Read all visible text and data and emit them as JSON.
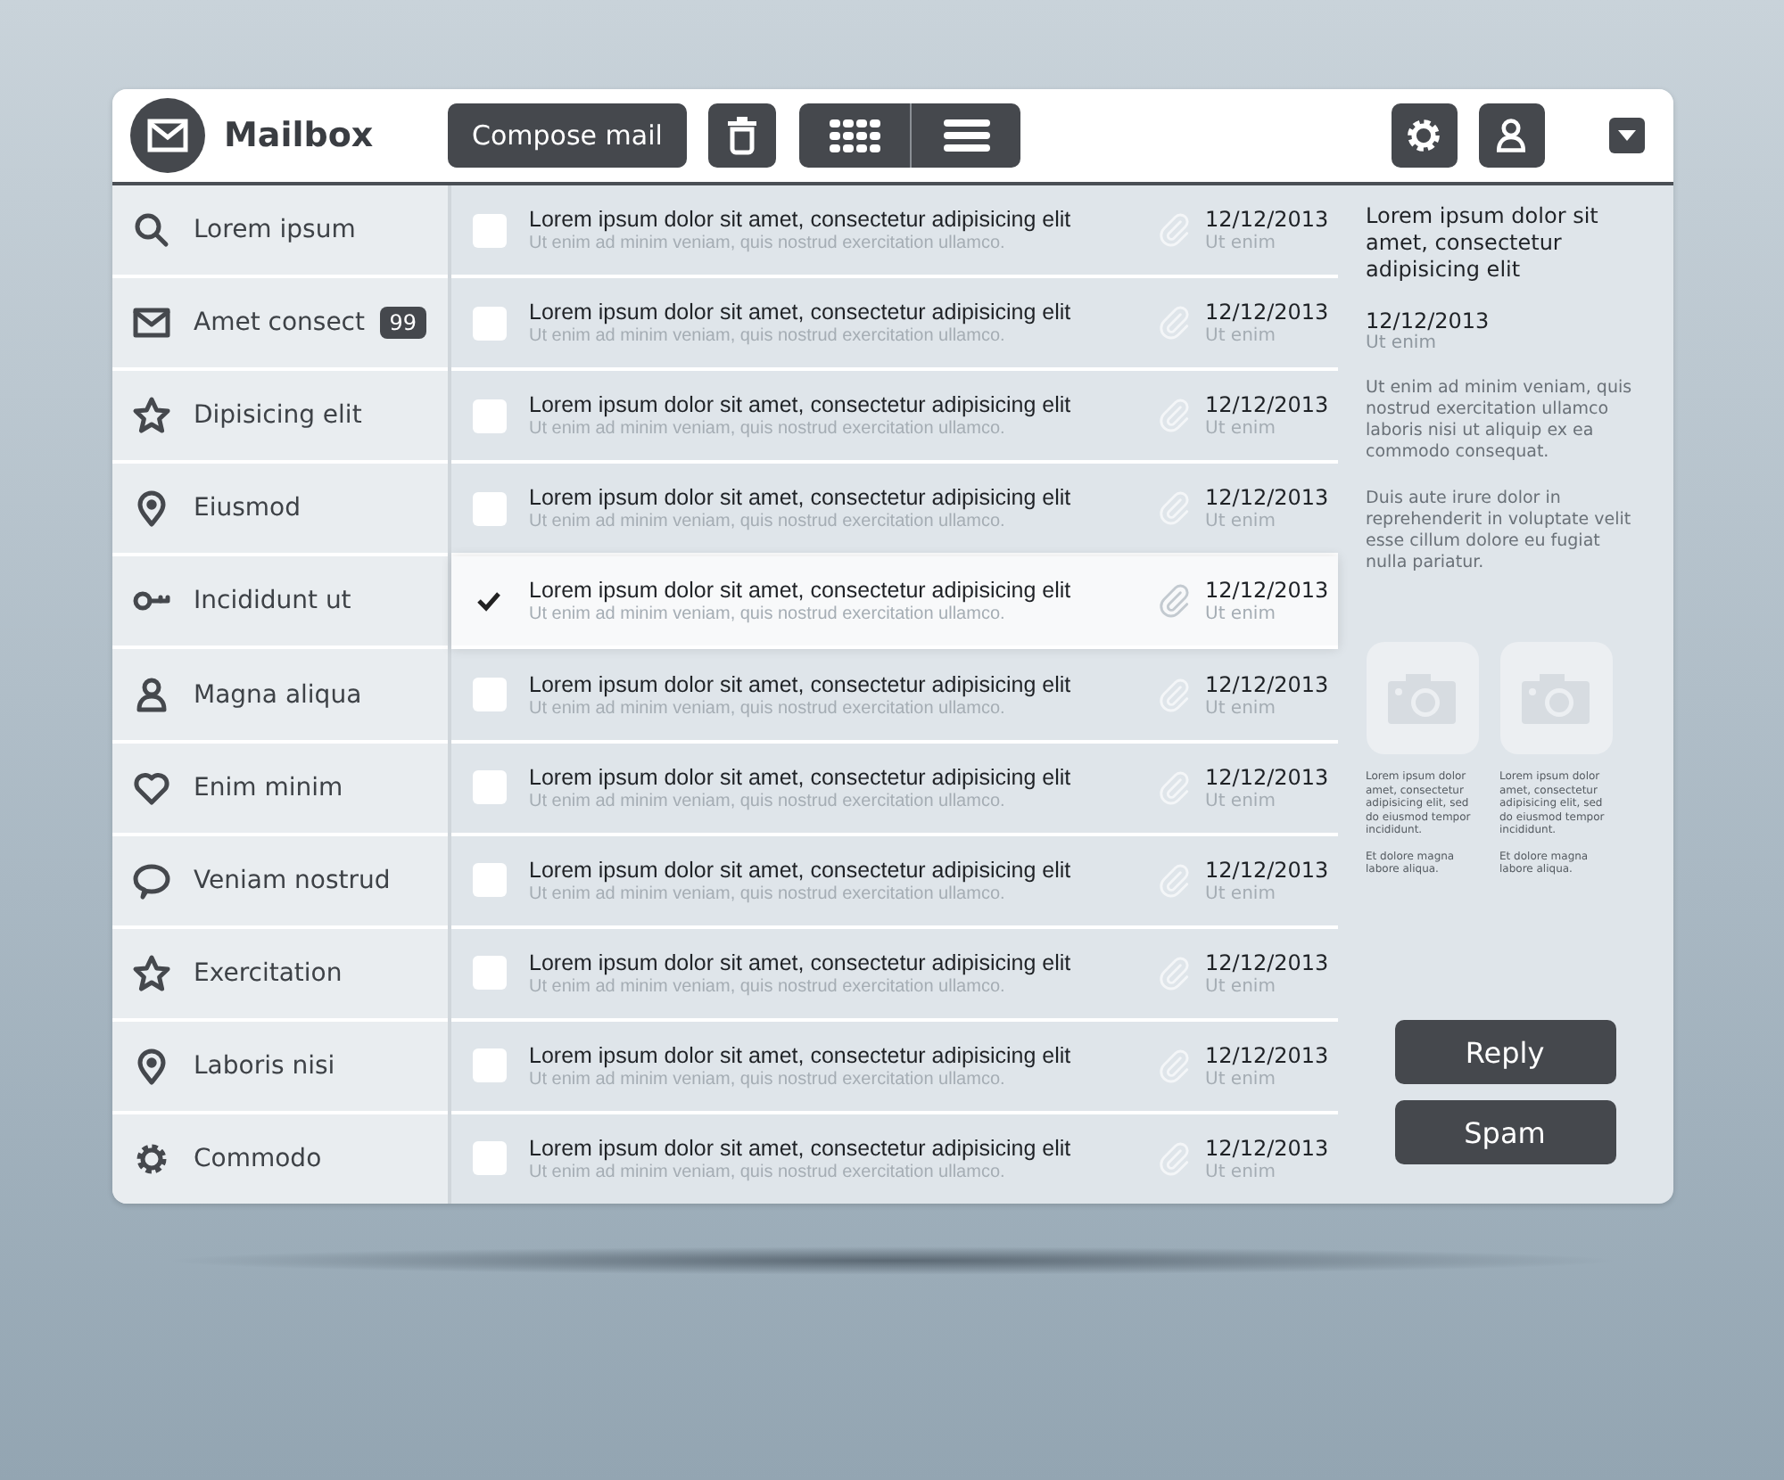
{
  "header": {
    "title": "Mailbox",
    "compose": "Compose mail"
  },
  "sidebar": {
    "items": [
      {
        "label": "Lorem ipsum",
        "selected": false
      },
      {
        "label": "Amet consect",
        "badge": "99",
        "selected": false
      },
      {
        "label": "Dipisicing elit",
        "selected": false
      },
      {
        "label": "Eiusmod",
        "selected": false
      },
      {
        "label": "Incididunt ut",
        "selected": false
      },
      {
        "label": "Magna aliqua",
        "selected": false
      },
      {
        "label": "Enim minim",
        "selected": false
      },
      {
        "label": "Veniam nostrud",
        "selected": false
      },
      {
        "label": "Exercitation",
        "selected": false
      },
      {
        "label": "Laboris nisi",
        "selected": false
      },
      {
        "label": "Commodo",
        "selected": false
      }
    ]
  },
  "messages": [
    {
      "subject": "Lorem ipsum dolor sit amet, consectetur adipisicing elit",
      "preview": "Ut enim ad minim veniam, quis nostrud exercitation ullamco.",
      "date": "12/12/2013",
      "note": "Ut enim",
      "checked": false,
      "selected": false
    },
    {
      "subject": "Lorem ipsum dolor sit amet, consectetur adipisicing elit",
      "preview": "Ut enim ad minim veniam, quis nostrud exercitation ullamco.",
      "date": "12/12/2013",
      "note": "Ut enim",
      "checked": false,
      "selected": false
    },
    {
      "subject": "Lorem ipsum dolor sit amet, consectetur adipisicing elit",
      "preview": "Ut enim ad minim veniam, quis nostrud exercitation ullamco.",
      "date": "12/12/2013",
      "note": "Ut enim",
      "checked": false,
      "selected": false
    },
    {
      "subject": "Lorem ipsum dolor sit amet, consectetur adipisicing elit",
      "preview": "Ut enim ad minim veniam, quis nostrud exercitation ullamco.",
      "date": "12/12/2013",
      "note": "Ut enim",
      "checked": false,
      "selected": false
    },
    {
      "subject": "Lorem ipsum dolor sit amet, consectetur adipisicing elit",
      "preview": "Ut enim ad minim veniam, quis nostrud exercitation ullamco.",
      "date": "12/12/2013",
      "note": "Ut enim",
      "checked": true,
      "selected": true
    },
    {
      "subject": "Lorem ipsum dolor sit amet, consectetur adipisicing elit",
      "preview": "Ut enim ad minim veniam, quis nostrud exercitation ullamco.",
      "date": "12/12/2013",
      "note": "Ut enim",
      "checked": false,
      "selected": false
    },
    {
      "subject": "Lorem ipsum dolor sit amet, consectetur adipisicing elit",
      "preview": "Ut enim ad minim veniam, quis nostrud exercitation ullamco.",
      "date": "12/12/2013",
      "note": "Ut enim",
      "checked": false,
      "selected": false
    },
    {
      "subject": "Lorem ipsum dolor sit amet, consectetur adipisicing elit",
      "preview": "Ut enim ad minim veniam, quis nostrud exercitation ullamco.",
      "date": "12/12/2013",
      "note": "Ut enim",
      "checked": false,
      "selected": false
    },
    {
      "subject": "Lorem ipsum dolor sit amet, consectetur adipisicing elit",
      "preview": "Ut enim ad minim veniam, quis nostrud exercitation ullamco.",
      "date": "12/12/2013",
      "note": "Ut enim",
      "checked": false,
      "selected": false
    },
    {
      "subject": "Lorem ipsum dolor sit amet, consectetur adipisicing elit",
      "preview": "Ut enim ad minim veniam, quis nostrud exercitation ullamco.",
      "date": "12/12/2013",
      "note": "Ut enim",
      "checked": false,
      "selected": false
    },
    {
      "subject": "Lorem ipsum dolor sit amet, consectetur adipisicing elit",
      "preview": "Ut enim ad minim veniam, quis nostrud exercitation ullamco.",
      "date": "12/12/2013",
      "note": "Ut enim",
      "checked": false,
      "selected": false
    }
  ],
  "reading_pane": {
    "subject": "Lorem ipsum dolor sit amet, consectetur adipisicing elit",
    "date": "12/12/2013",
    "note": "Ut enim",
    "paragraphs": [
      "Ut enim ad minim veniam, quis nostrud exercitation ullamco laboris nisi ut aliquip ex ea commodo consequat.",
      "Duis aute irure dolor in reprehenderit in voluptate velit esse cillum dolore eu fugiat nulla pariatur."
    ],
    "attachments": [
      {
        "caption": "Lorem ipsum dolor amet, consectetur adipisicing elit, sed do eiusmod tempor incididunt.",
        "caption_2": "Et dolore magna labore aliqua."
      },
      {
        "caption": "Lorem ipsum dolor amet, consectetur adipisicing elit, sed do eiusmod tempor incididunt.",
        "caption_2": "Et dolore magna labore aliqua."
      }
    ],
    "buttons": [
      "Reply",
      "Spam"
    ]
  }
}
